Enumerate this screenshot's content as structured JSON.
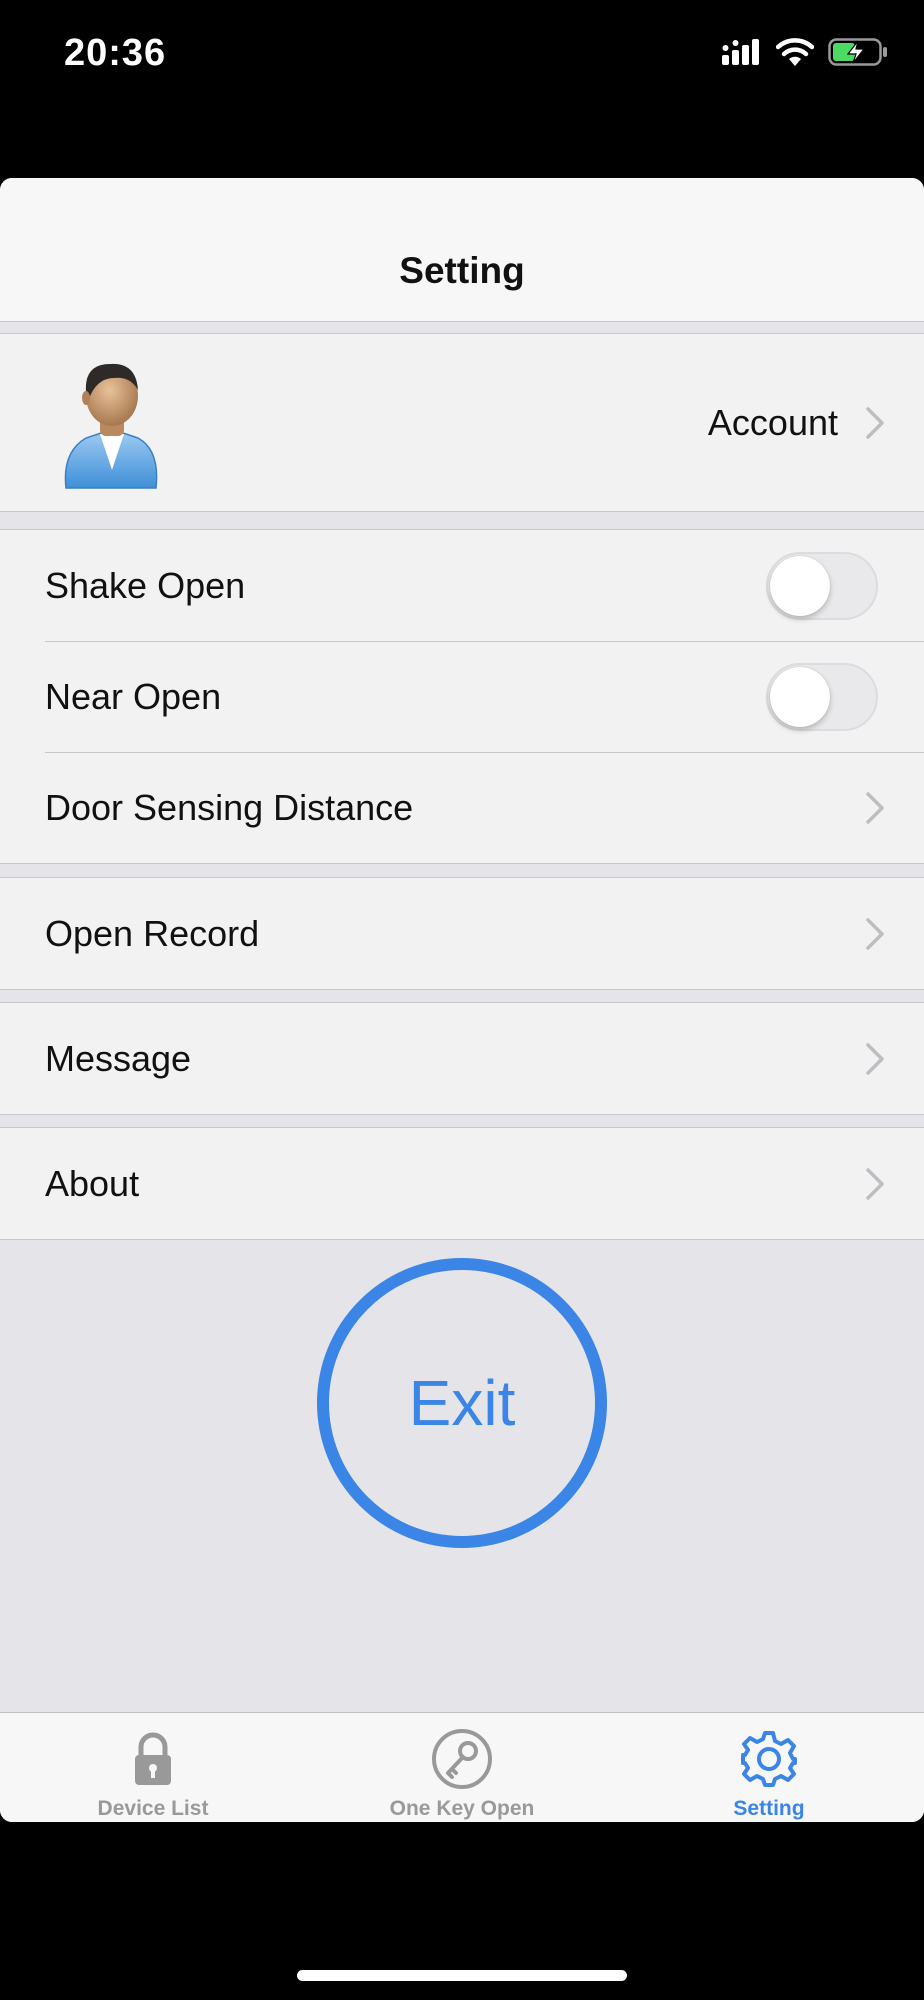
{
  "status_bar": {
    "time": "20:36"
  },
  "nav": {
    "title": "Setting"
  },
  "account": {
    "label": "Account"
  },
  "settings": {
    "shake_open": {
      "label": "Shake Open",
      "enabled": false
    },
    "near_open": {
      "label": "Near Open",
      "enabled": false
    },
    "door_sensing_distance": {
      "label": "Door Sensing Distance"
    }
  },
  "open_record": {
    "label": "Open Record"
  },
  "message": {
    "label": "Message"
  },
  "about": {
    "label": "About"
  },
  "exit": {
    "label": "Exit"
  },
  "tab_bar": {
    "tabs": [
      {
        "label": "Device List",
        "icon": "lock-icon",
        "active": false
      },
      {
        "label": "One Key Open",
        "icon": "key-icon",
        "active": false
      },
      {
        "label": "Setting",
        "icon": "gear-icon",
        "active": true
      }
    ]
  },
  "colors": {
    "accent": "#3a85e6",
    "inactive_tab": "#999999",
    "background": "#e4e4e9"
  }
}
